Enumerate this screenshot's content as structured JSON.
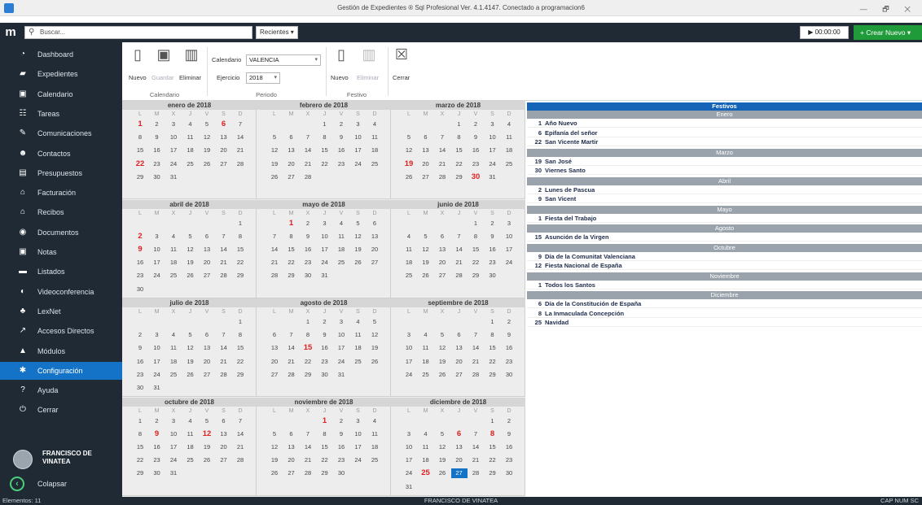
{
  "window": {
    "title": "Gestión de Expedientes ® Sql Profesional Ver. 4.1.4147. Conectado a programacion6",
    "controls": "— 🗗 ✕"
  },
  "topbar": {
    "search_placeholder": "Buscar...",
    "recent": "Recientes",
    "timer": "00:00:00",
    "create": "Crear Nuevo"
  },
  "sidebar": {
    "items": [
      {
        "label": "Dashboard",
        "icon": "dashboard-icon",
        "glyph": "◔"
      },
      {
        "label": "Expedientes",
        "icon": "briefcase-icon",
        "glyph": "▰"
      },
      {
        "label": "Calendario",
        "icon": "calendar-icon",
        "glyph": "▣"
      },
      {
        "label": "Tareas",
        "icon": "tasks-icon",
        "glyph": "☷"
      },
      {
        "label": "Comunicaciones",
        "icon": "comms-icon",
        "glyph": "✎"
      },
      {
        "label": "Contactos",
        "icon": "contacts-icon",
        "glyph": "☻"
      },
      {
        "label": "Presupuestos",
        "icon": "budget-icon",
        "glyph": "▤"
      },
      {
        "label": "Facturación",
        "icon": "billing-icon",
        "glyph": "⌂"
      },
      {
        "label": "Recibos",
        "icon": "receipts-icon",
        "glyph": "⌂"
      },
      {
        "label": "Documentos",
        "icon": "documents-icon",
        "glyph": "◉"
      },
      {
        "label": "Notas",
        "icon": "notes-icon",
        "glyph": "▣"
      },
      {
        "label": "Listados",
        "icon": "listings-icon",
        "glyph": "▬"
      },
      {
        "label": "Videoconferencia",
        "icon": "video-icon",
        "glyph": "◐"
      },
      {
        "label": "LexNet",
        "icon": "lexnet-icon",
        "glyph": "♣"
      },
      {
        "label": "Accesos Directos",
        "icon": "shortcuts-icon",
        "glyph": "↗"
      },
      {
        "label": "Módulos",
        "icon": "modules-icon",
        "glyph": "▲"
      },
      {
        "label": "Configuración",
        "icon": "gear-icon",
        "glyph": "✱"
      },
      {
        "label": "Ayuda",
        "icon": "help-icon",
        "glyph": "?"
      },
      {
        "label": "Cerrar",
        "icon": "power-icon",
        "glyph": "⏻"
      }
    ],
    "active": 16,
    "user": "FRANCISCO DE VINATEA",
    "collapse": "Colapsar"
  },
  "ribbon": {
    "cal_new": "Nuevo",
    "cal_save": "Guardar",
    "cal_delete": "Eliminar",
    "group_calendar": "Calendario",
    "calendar_label": "Calendario",
    "calendar_value": "VALENCIA",
    "year_label": "Ejercicio",
    "year_value": "2018",
    "group_period": "Periodo",
    "fest_new": "Nuevo",
    "fest_delete": "Eliminar",
    "group_festivo": "Festivo",
    "close": "Cerrar"
  },
  "calendar": {
    "weekdays": [
      "L",
      "M",
      "X",
      "J",
      "V",
      "S",
      "D"
    ],
    "months": [
      {
        "name": "enero de 2018",
        "start": 0,
        "days": 31,
        "fest": [
          1,
          6,
          22
        ]
      },
      {
        "name": "febrero de 2018",
        "start": 3,
        "days": 28,
        "fest": []
      },
      {
        "name": "marzo de 2018",
        "start": 3,
        "days": 31,
        "fest": [
          19,
          30
        ]
      },
      {
        "name": "abril de 2018",
        "start": 6,
        "days": 30,
        "fest": [
          2,
          9
        ]
      },
      {
        "name": "mayo de 2018",
        "start": 1,
        "days": 31,
        "fest": [
          1
        ]
      },
      {
        "name": "junio de 2018",
        "start": 4,
        "days": 30,
        "fest": []
      },
      {
        "name": "julio de 2018",
        "start": 6,
        "days": 31,
        "fest": []
      },
      {
        "name": "agosto de 2018",
        "start": 2,
        "days": 31,
        "fest": [
          15
        ]
      },
      {
        "name": "septiembre de 2018",
        "start": 5,
        "days": 30,
        "fest": []
      },
      {
        "name": "octubre de 2018",
        "start": 0,
        "days": 31,
        "fest": [
          9,
          12
        ]
      },
      {
        "name": "noviembre de 2018",
        "start": 3,
        "days": 30,
        "fest": [
          1
        ]
      },
      {
        "name": "diciembre de 2018",
        "start": 5,
        "days": 31,
        "fest": [
          6,
          8,
          25
        ],
        "selected": 27
      }
    ]
  },
  "festivos": {
    "title": "Festivos",
    "groups": [
      {
        "month": "Enero",
        "items": [
          [
            "1",
            "Año Nuevo"
          ],
          [
            "6",
            "Epifanía del señor"
          ],
          [
            "22",
            "San Vicente Martir"
          ]
        ]
      },
      {
        "month": "Marzo",
        "items": [
          [
            "19",
            "San José"
          ],
          [
            "30",
            "Viernes Santo"
          ]
        ]
      },
      {
        "month": "Abril",
        "items": [
          [
            "2",
            "Lunes de Pascua"
          ],
          [
            "9",
            "San Vicent"
          ]
        ]
      },
      {
        "month": "Mayo",
        "items": [
          [
            "1",
            "Fiesta del Trabajo"
          ]
        ]
      },
      {
        "month": "Agosto",
        "items": [
          [
            "15",
            "Asunción de la Virgen"
          ]
        ]
      },
      {
        "month": "Octubre",
        "items": [
          [
            "9",
            "Día de la Comunitat Valenciana"
          ],
          [
            "12",
            "Fiesta Nacional de España"
          ]
        ]
      },
      {
        "month": "Noviembre",
        "items": [
          [
            "1",
            "Todos los Santos"
          ]
        ]
      },
      {
        "month": "Diciembre",
        "items": [
          [
            "6",
            "Día de la Constitución de España"
          ],
          [
            "8",
            "La Inmaculada Concepción"
          ],
          [
            "25",
            "Navidad"
          ]
        ]
      }
    ]
  },
  "status": {
    "left": "Elementos: 11",
    "center": "FRANCISCO DE VINATEA",
    "right": "CAP  NUM  SC"
  }
}
